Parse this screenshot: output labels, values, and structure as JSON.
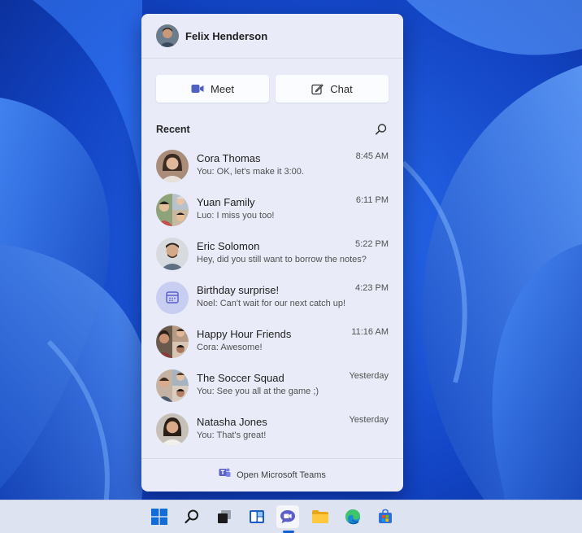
{
  "profile": {
    "name": "Felix Henderson"
  },
  "actions": {
    "meet_label": "Meet",
    "chat_label": "Chat"
  },
  "recent": {
    "title": "Recent",
    "conversations": [
      {
        "name": "Cora Thomas",
        "preview": "You: OK, let's make it 3:00.",
        "time": "8:45 AM"
      },
      {
        "name": "Yuan Family",
        "preview": "Luo: I miss you too!",
        "time": "6:11 PM"
      },
      {
        "name": "Eric Solomon",
        "preview": "Hey, did you still want to borrow the notes?",
        "time": "5:22 PM"
      },
      {
        "name": "Birthday surprise!",
        "preview": "Noel: Can't wait for our next catch up!",
        "time": "4:23 PM"
      },
      {
        "name": "Happy Hour Friends",
        "preview": "Cora: Awesome!",
        "time": "11:16 AM"
      },
      {
        "name": "The Soccer Squad",
        "preview": "You: See you all at the game ;)",
        "time": "Yesterday"
      },
      {
        "name": "Natasha Jones",
        "preview": "You: That's great!",
        "time": "Yesterday"
      }
    ]
  },
  "footer": {
    "open_teams_label": "Open Microsoft Teams"
  },
  "taskbar": {
    "icons": [
      "windows-start-icon",
      "search-icon",
      "task-view-icon",
      "widgets-icon",
      "teams-chat-icon",
      "file-explorer-icon",
      "edge-browser-icon",
      "microsoft-store-icon"
    ]
  },
  "colors": {
    "accent": "#0f5fd2",
    "flyout_bg": "#e9ecf8",
    "wallpaper_blue": "#1549c8",
    "teams_purple": "#5b5fc7"
  }
}
